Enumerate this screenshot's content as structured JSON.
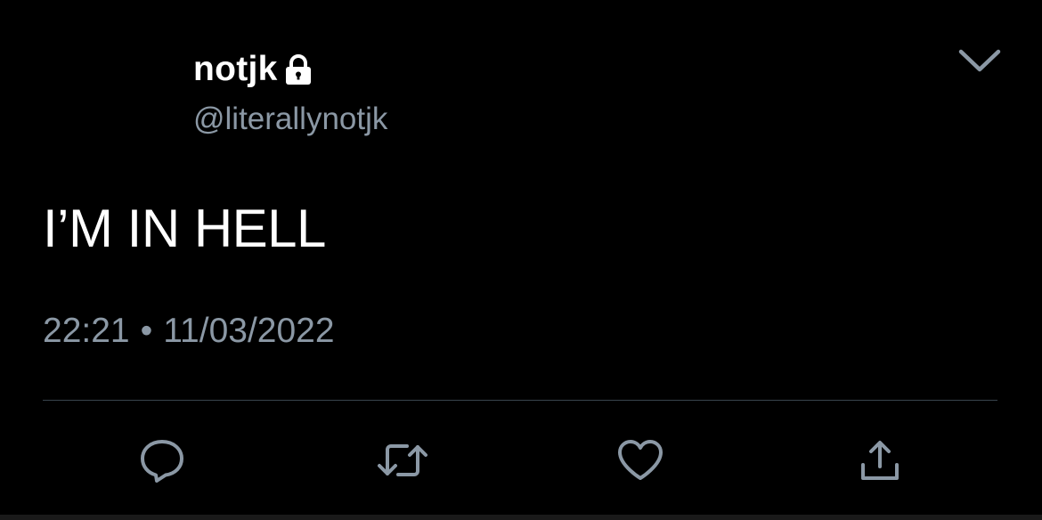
{
  "user": {
    "display_name": "notjk",
    "handle": "@literallynotjk",
    "protected_icon": "lock-icon"
  },
  "tweet": {
    "text": "I’M IN HELL",
    "time": "22:21",
    "separator": "•",
    "date": "11/03/2022"
  },
  "header": {
    "more_icon": "chevron-down-icon"
  },
  "actions": [
    {
      "name": "reply",
      "icon": "reply-icon"
    },
    {
      "name": "retweet",
      "icon": "retweet-icon"
    },
    {
      "name": "like",
      "icon": "heart-icon"
    },
    {
      "name": "share",
      "icon": "share-icon"
    }
  ],
  "colors": {
    "background": "#000000",
    "primary_text": "#ffffff",
    "secondary_text": "#8b98a5",
    "divider": "#38444d",
    "icon": "#8b98a5"
  }
}
